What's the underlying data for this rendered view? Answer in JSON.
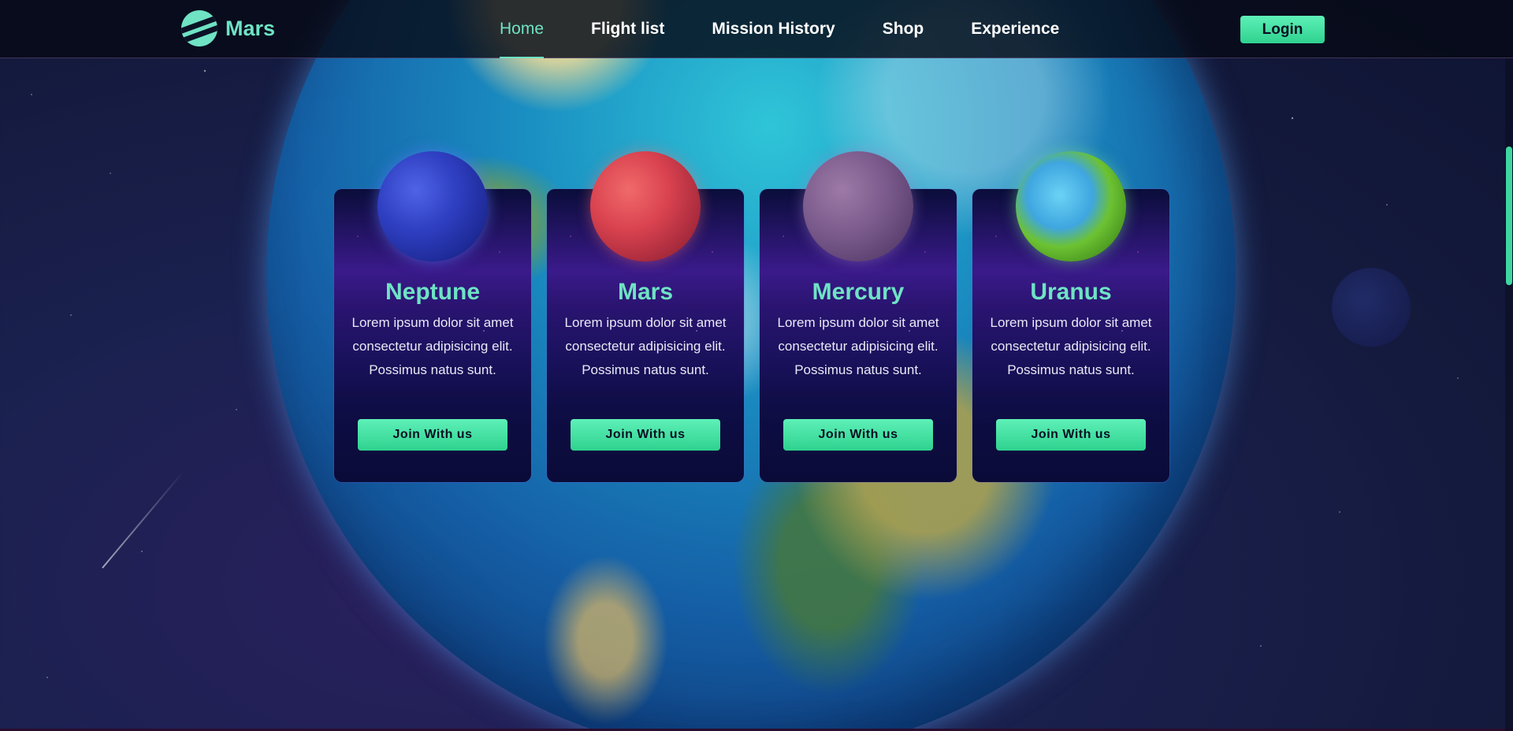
{
  "app": {
    "brand": "Mars"
  },
  "header": {
    "nav": [
      {
        "label": "Home",
        "active": true
      },
      {
        "label": "Flight list",
        "active": false
      },
      {
        "label": "Mission History",
        "active": false
      },
      {
        "label": "Shop",
        "active": false
      },
      {
        "label": "Experience",
        "active": false
      }
    ],
    "login_label": "Login"
  },
  "cards": [
    {
      "title": "Neptune",
      "description": "Lorem ipsum dolor sit amet consectetur adipisicing elit. Possimus natus sunt.",
      "button": "Join With us",
      "planet_icon": "neptune-planet"
    },
    {
      "title": "Mars",
      "description": "Lorem ipsum dolor sit amet consectetur adipisicing elit. Possimus natus sunt.",
      "button": "Join With us",
      "planet_icon": "mars-planet"
    },
    {
      "title": "Mercury",
      "description": "Lorem ipsum dolor sit amet consectetur adipisicing elit. Possimus natus sunt.",
      "button": "Join With us",
      "planet_icon": "mercury-planet"
    },
    {
      "title": "Uranus",
      "description": "Lorem ipsum dolor sit amet consectetur adipisicing elit. Possimus natus sunt.",
      "button": "Join With us",
      "planet_icon": "uranus-planet"
    }
  ],
  "colors": {
    "accent": "#6fe3c4",
    "button": "#3fe0a2",
    "header_bg": "#060a16"
  }
}
